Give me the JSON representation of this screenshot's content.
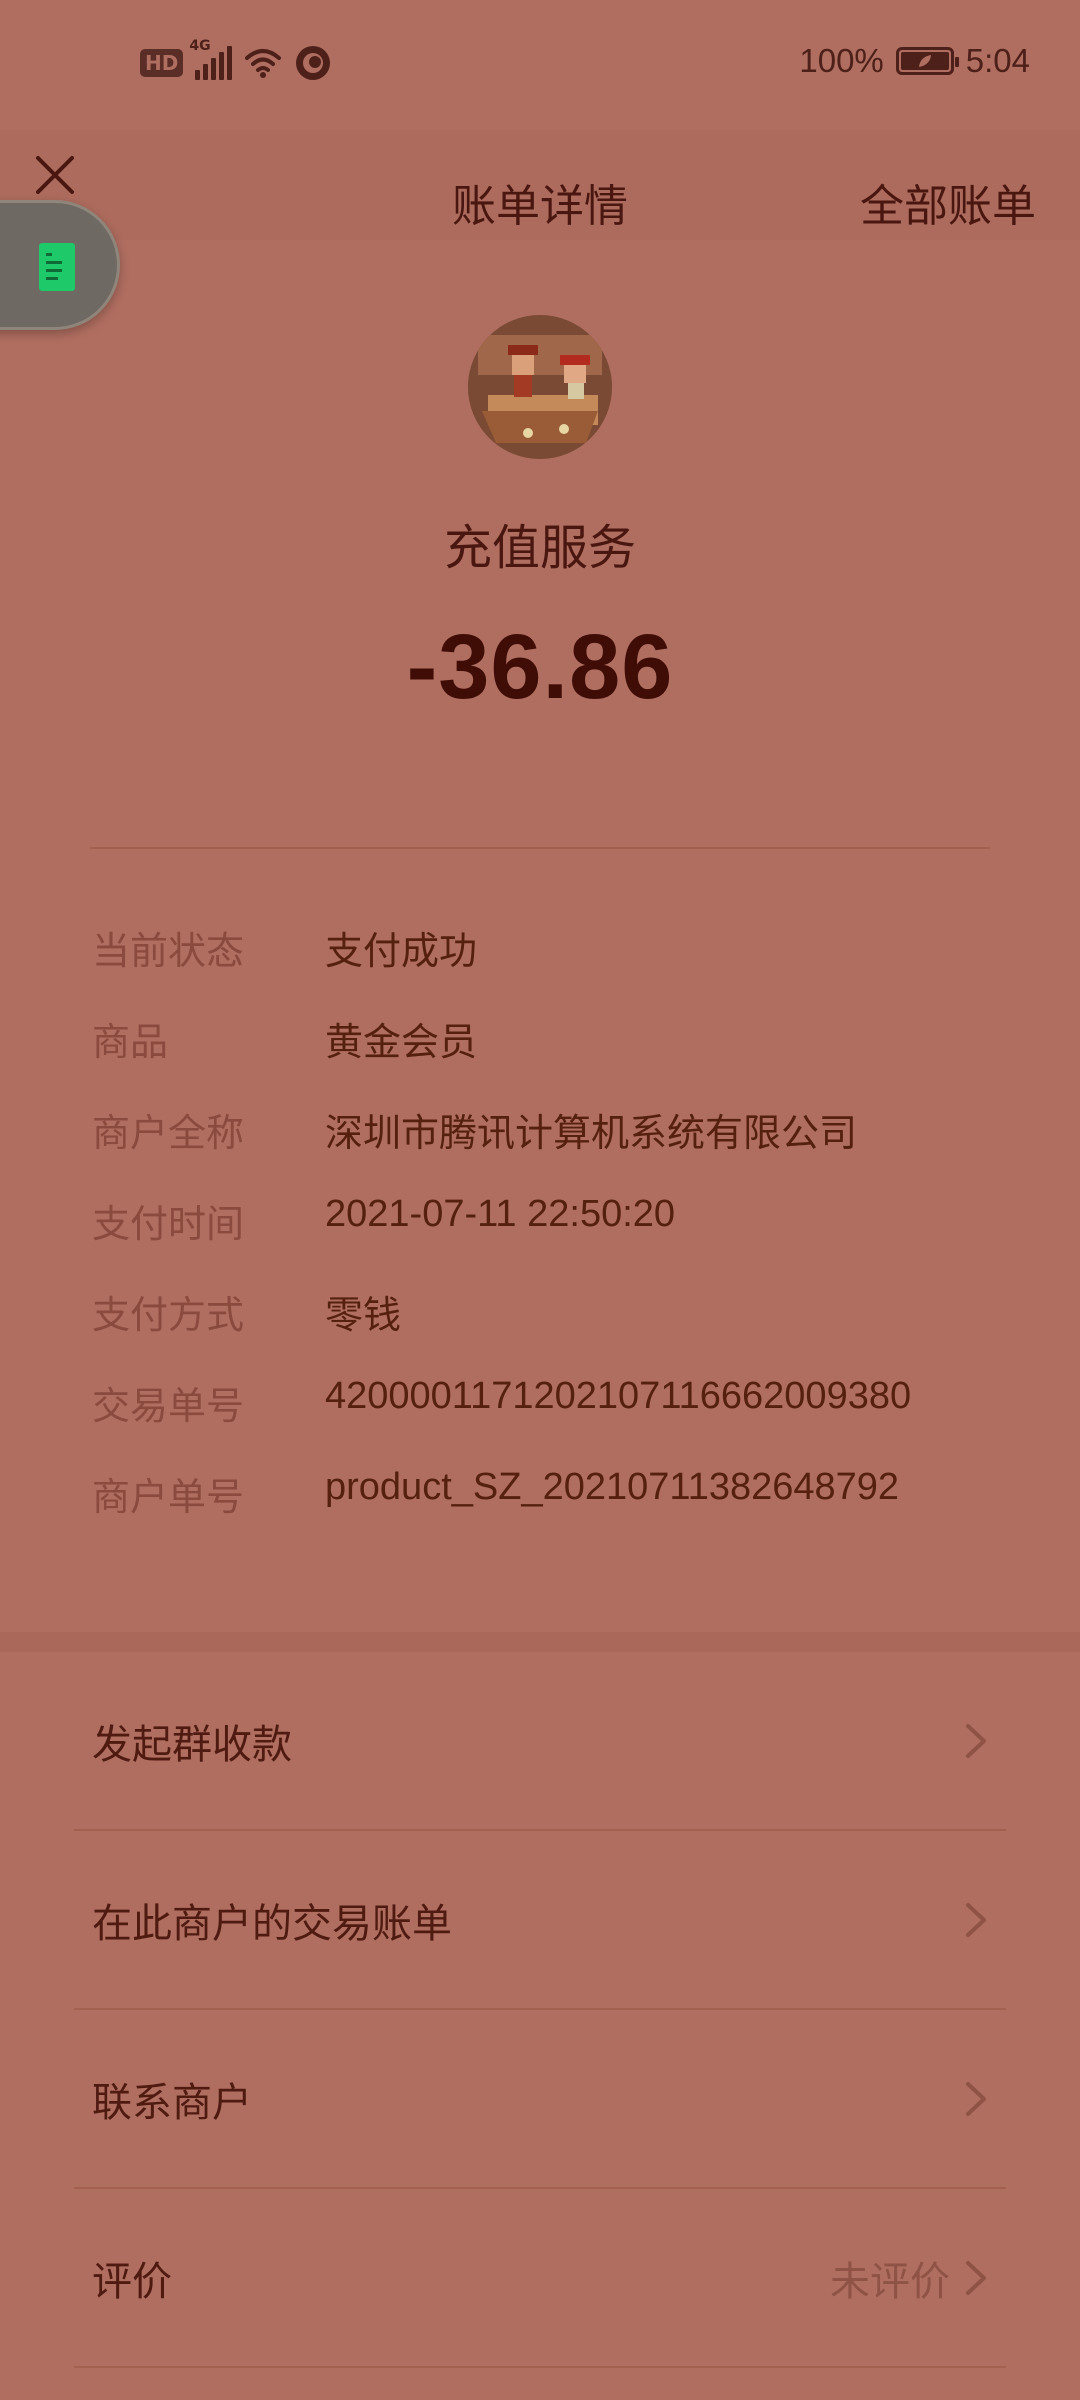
{
  "status_bar": {
    "hd": "HD",
    "network": "4G",
    "battery_percent": "100%",
    "time": "5:04"
  },
  "header": {
    "title": "账单详情",
    "all_bills": "全部账单"
  },
  "merchant": {
    "name": "充值服务",
    "amount": "-36.86"
  },
  "details": [
    {
      "label": "当前状态",
      "value": "支付成功"
    },
    {
      "label": "商品",
      "value": "黄金会员"
    },
    {
      "label": "商户全称",
      "value": "深圳市腾讯计算机系统有限公司"
    },
    {
      "label": "支付时间",
      "value": "2021-07-11 22:50:20"
    },
    {
      "label": "支付方式",
      "value": "零钱"
    },
    {
      "label": "交易单号",
      "value": "4200001171202107116662009380"
    },
    {
      "label": "商户单号",
      "value": "product_SZ_20210711382648792"
    }
  ],
  "actions": [
    {
      "label": "发起群收款",
      "status": ""
    },
    {
      "label": "在此商户的交易账单",
      "status": ""
    },
    {
      "label": "联系商户",
      "status": ""
    },
    {
      "label": "评价",
      "status": "未评价"
    }
  ],
  "colors": {
    "background": "#b06e60",
    "text_dark": "#4a1710",
    "text_muted": "#8a4a3e",
    "bubble_icon": "#1ec96a"
  }
}
